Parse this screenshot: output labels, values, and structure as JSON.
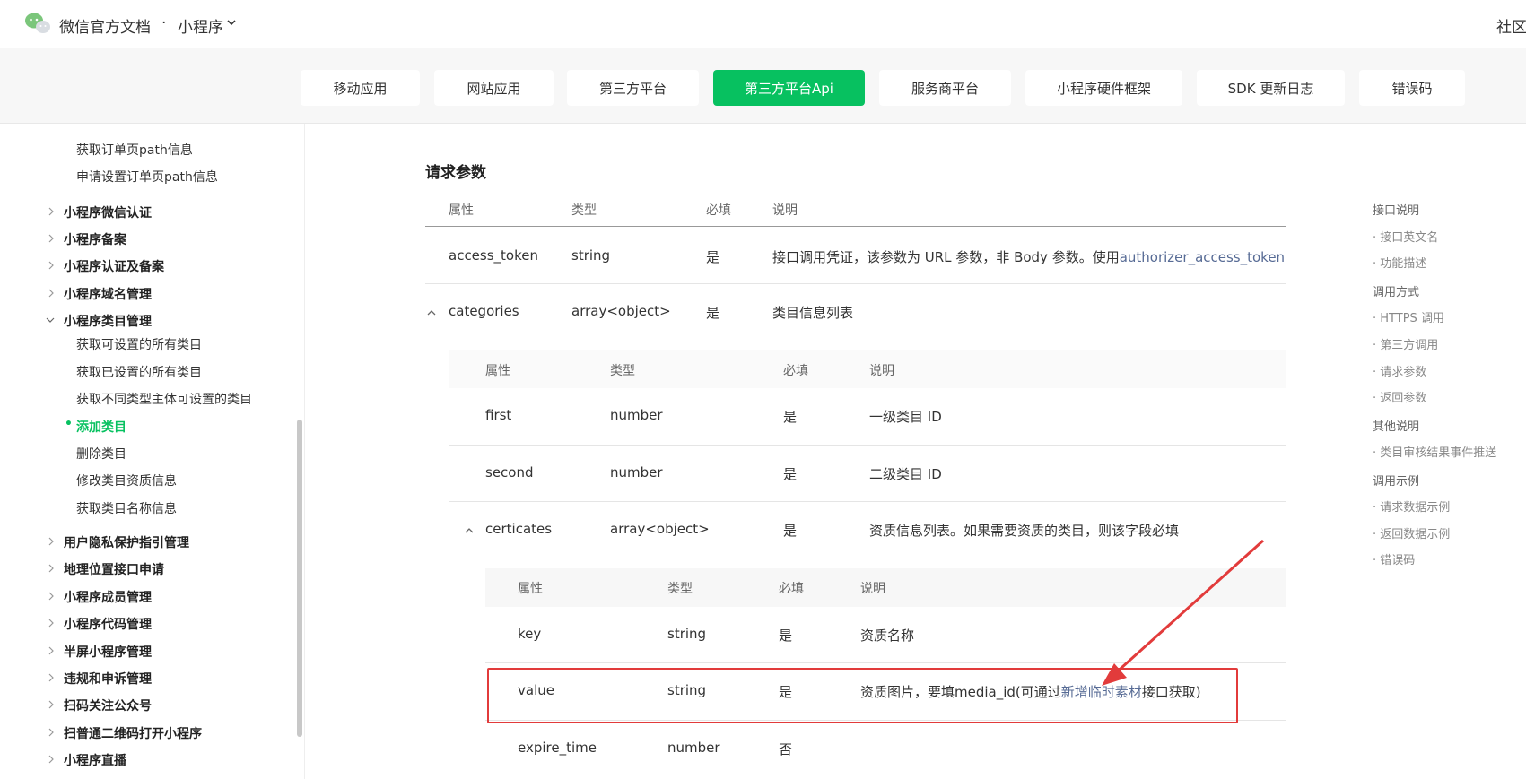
{
  "header": {
    "brand": "微信官方文档",
    "separator": "·",
    "product": "小程序",
    "community": "社区"
  },
  "nav": {
    "tabs": [
      {
        "label": "移动应用",
        "active": false
      },
      {
        "label": "网站应用",
        "active": false
      },
      {
        "label": "第三方平台",
        "active": false
      },
      {
        "label": "第三方平台Api",
        "active": true
      },
      {
        "label": "服务商平台",
        "active": false
      },
      {
        "label": "小程序硬件框架",
        "active": false
      },
      {
        "label": "SDK 更新日志",
        "active": false
      },
      {
        "label": "错误码",
        "active": false
      }
    ]
  },
  "sidebar": {
    "items": [
      {
        "label": "获取订单页path信息",
        "type": "child"
      },
      {
        "label": "申请设置订单页path信息",
        "type": "child"
      },
      {
        "label": "小程序微信认证",
        "type": "group"
      },
      {
        "label": "小程序备案",
        "type": "group"
      },
      {
        "label": "小程序认证及备案",
        "type": "group"
      },
      {
        "label": "小程序域名管理",
        "type": "group"
      },
      {
        "label": "小程序类目管理",
        "type": "group-open"
      },
      {
        "label": "获取可设置的所有类目",
        "type": "child"
      },
      {
        "label": "获取已设置的所有类目",
        "type": "child"
      },
      {
        "label": "获取不同类型主体可设置的类目",
        "type": "child"
      },
      {
        "label": "添加类目",
        "type": "active"
      },
      {
        "label": "删除类目",
        "type": "child"
      },
      {
        "label": "修改类目资质信息",
        "type": "child"
      },
      {
        "label": "获取类目名称信息",
        "type": "child"
      },
      {
        "label": "用户隐私保护指引管理",
        "type": "group"
      },
      {
        "label": "地理位置接口申请",
        "type": "group"
      },
      {
        "label": "小程序成员管理",
        "type": "group"
      },
      {
        "label": "小程序代码管理",
        "type": "group"
      },
      {
        "label": "半屏小程序管理",
        "type": "group"
      },
      {
        "label": "违规和申诉管理",
        "type": "group"
      },
      {
        "label": "扫码关注公众号",
        "type": "group"
      },
      {
        "label": "扫普通二维码打开小程序",
        "type": "group"
      },
      {
        "label": "小程序直播",
        "type": "group"
      }
    ]
  },
  "main": {
    "section_title": "请求参数",
    "headers": {
      "attr": "属性",
      "type": "类型",
      "required": "必填",
      "desc": "说明"
    },
    "rows": {
      "access_token": {
        "name": "access_token",
        "type": "string",
        "required": "是",
        "desc": "接口调用凭证，该参数为 URL 参数，非 Body 参数。使用",
        "link": "authorizer_access_token"
      },
      "categories": {
        "name": "categories",
        "type": "array<object>",
        "required": "是",
        "desc": "类目信息列表"
      }
    },
    "sub1": {
      "first": {
        "name": "first",
        "type": "number",
        "required": "是",
        "desc": "一级类目 ID"
      },
      "second": {
        "name": "second",
        "type": "number",
        "required": "是",
        "desc": "二级类目 ID"
      },
      "certicates": {
        "name": "certicates",
        "type": "array<object>",
        "required": "是",
        "desc": "资质信息列表。如果需要资质的类目，则该字段必填"
      }
    },
    "sub2": {
      "key": {
        "name": "key",
        "type": "string",
        "required": "是",
        "desc": "资质名称"
      },
      "value": {
        "name": "value",
        "type": "string",
        "required": "是",
        "desc_pre": "资质图片，要填media_id(可通过",
        "link": "新增临时素材",
        "desc_post": "接口获取)"
      },
      "expire_time": {
        "name": "expire_time",
        "type": "number",
        "required": "否",
        "desc": ""
      }
    }
  },
  "toc": {
    "items": [
      {
        "label": "接口说明",
        "sub": false
      },
      {
        "label": "· 接口英文名",
        "sub": true
      },
      {
        "label": "· 功能描述",
        "sub": true
      },
      {
        "label": "调用方式",
        "sub": false
      },
      {
        "label": "· HTTPS 调用",
        "sub": true
      },
      {
        "label": "· 第三方调用",
        "sub": true
      },
      {
        "label": "· 请求参数",
        "sub": true
      },
      {
        "label": "· 返回参数",
        "sub": true
      },
      {
        "label": "其他说明",
        "sub": false
      },
      {
        "label": "· 类目审核结果事件推送",
        "sub": true
      },
      {
        "label": "调用示例",
        "sub": false
      },
      {
        "label": "· 请求数据示例",
        "sub": true
      },
      {
        "label": "· 返回数据示例",
        "sub": true
      },
      {
        "label": "· 错误码",
        "sub": true
      }
    ]
  },
  "colors": {
    "accent": "#07c160",
    "link": "#576b95",
    "annotation": "#e23b3b"
  },
  "icons": [
    "wechat-logo-icon",
    "chevron-down-icon",
    "chevron-right-icon",
    "caret-up-icon"
  ]
}
